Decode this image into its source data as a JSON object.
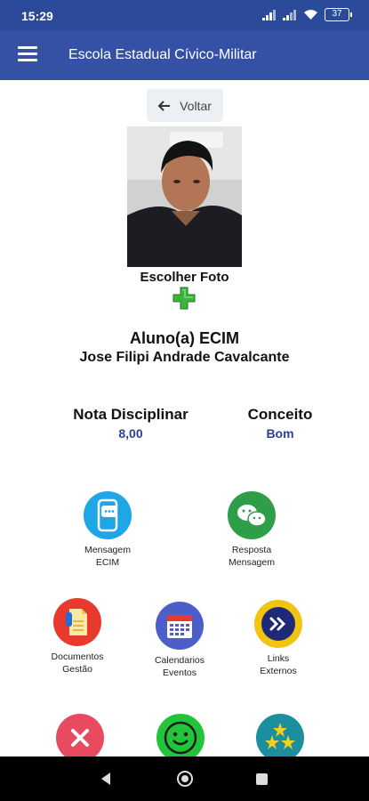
{
  "status_bar": {
    "time": "15:29",
    "battery": "37"
  },
  "app_bar": {
    "title": "Escola Estadual Cívico-Militar",
    "menu_icon": "hamburger-menu-icon"
  },
  "back_button": {
    "label": "Voltar",
    "icon": "arrow-left-icon"
  },
  "photo": {
    "choose_label": "Escolher Foto",
    "add_icon": "green-plus-icon"
  },
  "student": {
    "type": "Aluno(a) ECIM",
    "name": "Jose Filipi Andrade Cavalcante"
  },
  "grades": {
    "discipline_label": "Nota Disciplinar",
    "discipline_value": "8,00",
    "concept_label": "Conceito",
    "concept_value": "Bom"
  },
  "actions": [
    {
      "label": "Mensagem\nECIM",
      "icon": "phone-chat-icon",
      "color": "#1fa6e6"
    },
    {
      "label": "Resposta\nMensagem",
      "icon": "wechat-bubbles-icon",
      "color": "#2e9e49"
    },
    {
      "label": "Documentos\nGestão",
      "icon": "documents-icon",
      "color": "#e8392f"
    },
    {
      "label": "Calendarios\nEventos",
      "icon": "calendar-icon",
      "color": "#4c5fc9"
    },
    {
      "label": "Links\nExternos",
      "icon": "double-chevron-right-icon",
      "color": "#f1c40f"
    },
    {
      "label": "",
      "icon": "close-x-icon",
      "color": "#e84a5f"
    },
    {
      "label": "",
      "icon": "smiley-face-icon",
      "color": "#22c43a"
    },
    {
      "label": "",
      "icon": "stars-icon",
      "color": "#1b8f9e"
    }
  ],
  "nav_bar": {
    "back_icon": "nav-back-icon",
    "home_icon": "nav-home-icon",
    "recent_icon": "nav-recents-icon"
  }
}
